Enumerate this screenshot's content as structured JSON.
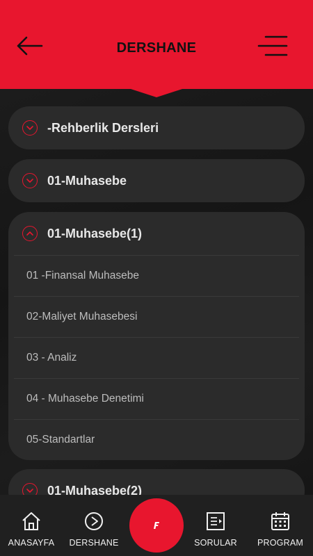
{
  "header": {
    "title": "DERSHANE",
    "accent_color": "#e8162e",
    "back_icon": "arrow-left-icon",
    "menu_icon": "hamburger-menu-icon"
  },
  "sections": [
    {
      "title": "-Rehberlik Dersleri",
      "expanded": false,
      "items": []
    },
    {
      "title": "01-Muhasebe",
      "expanded": false,
      "items": []
    },
    {
      "title": "01-Muhasebe(1)",
      "expanded": true,
      "items": [
        "01 -Finansal Muhasebe",
        "02-Maliyet Muhasebesi",
        "03 - Analiz",
        "04 - Muhasebe Denetimi",
        "05-Standartlar"
      ]
    },
    {
      "title": "01-Muhasebe(2)",
      "expanded": false,
      "items": []
    }
  ],
  "bottom_nav": {
    "items": [
      {
        "label": "ANASAYFA",
        "icon": "home-icon"
      },
      {
        "label": "DERSHANE",
        "icon": "play-circle-icon"
      },
      {
        "label": "SORULAR",
        "icon": "questions-list-icon"
      },
      {
        "label": "PROGRAM",
        "icon": "calendar-icon"
      }
    ],
    "center_icon": "logo-f-icon",
    "center_letter": "F"
  }
}
